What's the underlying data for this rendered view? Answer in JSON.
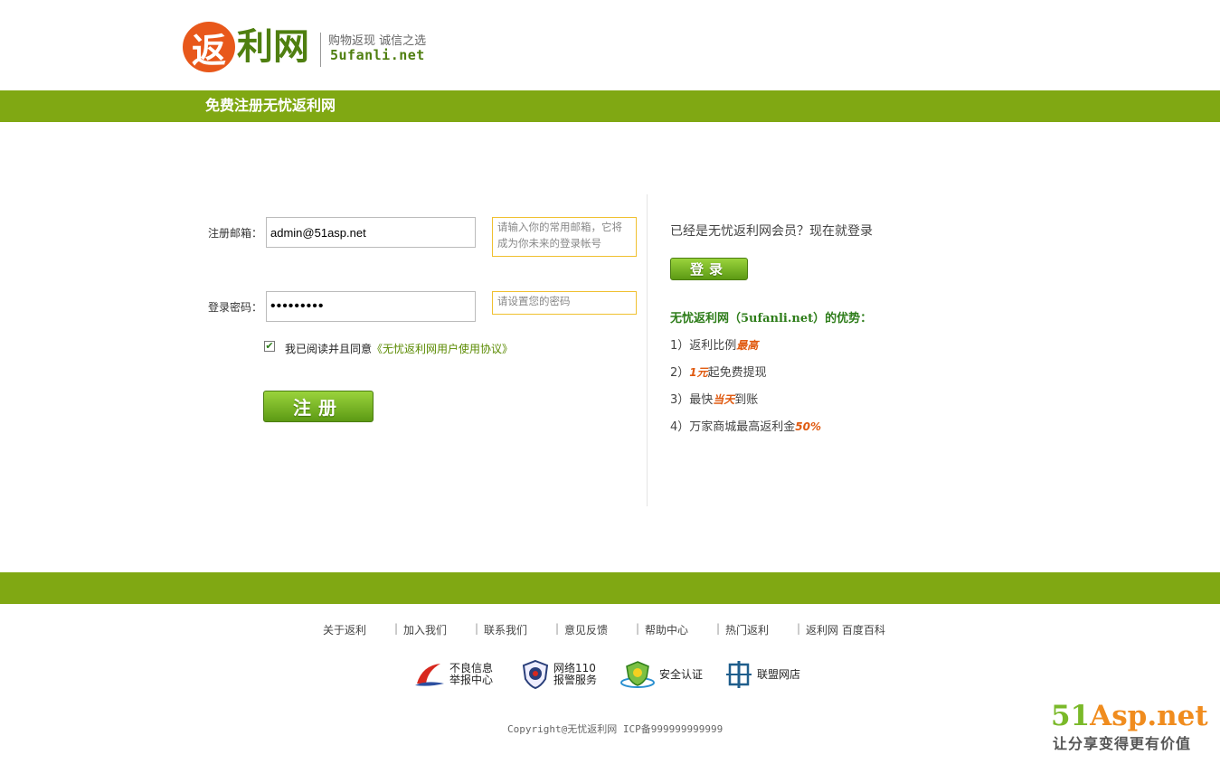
{
  "header": {
    "logo_mark": "返",
    "logo_rest": "利网",
    "slogan": "购物返现 诚信之选",
    "domain": "5ufanli.net",
    "banner_title": "免费注册无忧返利网"
  },
  "form": {
    "email_label": "注册邮箱：",
    "email_value": "admin@51asp.net",
    "email_hint": "请输入你的常用邮箱，它将成为你未来的登录帐号",
    "password_label": "登录密码：",
    "password_value": "123456789",
    "password_hint": "请设置您的密码",
    "agree_checked": true,
    "agree_text": "我已阅读并且同意",
    "agree_link": "《无忧返利网用户使用协议》",
    "register_button": "注册"
  },
  "login_panel": {
    "member_text": "已经是无忧返利网会员？现在就登录",
    "login_button": "登录",
    "advantages_title": "无忧返利网（5ufanli.net）的优势：",
    "advantages": [
      {
        "prefix": "1）返利比例",
        "em": "最高",
        "suffix": ""
      },
      {
        "prefix": "2）",
        "em": "1元",
        "suffix": "起免费提现"
      },
      {
        "prefix": "3）最快",
        "em": "当天",
        "suffix": "到账"
      },
      {
        "prefix": "4）万家商城最高返利金",
        "em": "50%",
        "suffix": ""
      }
    ]
  },
  "footer": {
    "links": [
      "关于返利",
      "加入我们",
      "联系我们",
      "意见反馈",
      "帮助中心",
      "热门返利",
      "返利网 百度百科"
    ],
    "separator": "|",
    "badges": [
      {
        "line1": "不良信息",
        "line2": "举报中心",
        "icon": "report-center-icon"
      },
      {
        "line1": "网络110",
        "line2": "报警服务",
        "icon": "police-shield-icon"
      },
      {
        "line1": "安全认证",
        "line2": "",
        "icon": "security-cert-icon"
      },
      {
        "line1": "联盟网店",
        "line2": "",
        "icon": "alliance-store-icon"
      }
    ],
    "copyright": "Copyright@无忧返利网 ICP备999999999999"
  },
  "watermark": {
    "main_51": "51",
    "main_asp": "Asp.net",
    "sub": "让分享变得更有价值"
  },
  "colors": {
    "brand_green": "#80a813",
    "logo_orange": "#e8581b",
    "accent_orange": "#e05a10",
    "hint_border": "#f0c030"
  }
}
